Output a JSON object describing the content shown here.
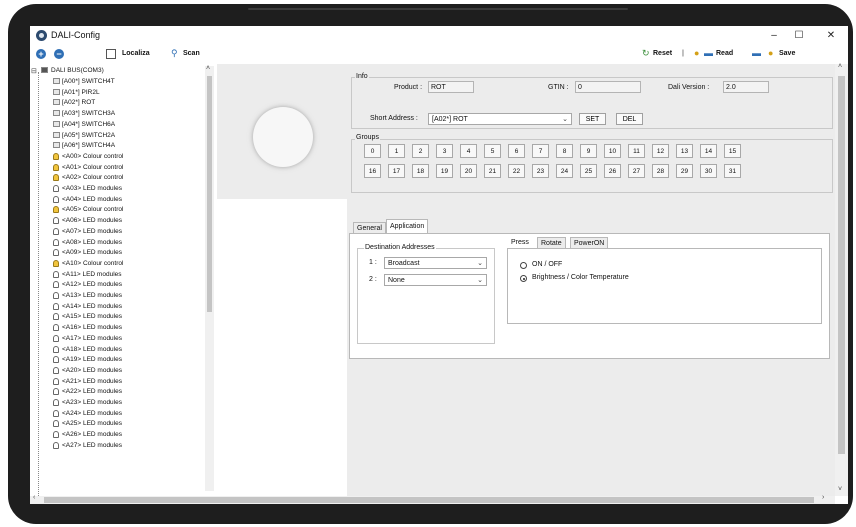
{
  "window": {
    "title": "DALI-Config",
    "controls": [
      "–",
      "☐",
      "✕"
    ]
  },
  "toolbar": {
    "add_icon": "+",
    "remove_icon": "−",
    "localiza_label": "Localiza",
    "scan_label": "Scan",
    "reset_label": "Reset",
    "separator": "|",
    "read_label": "Read",
    "save_label": "Save"
  },
  "tree": {
    "root": "DALI BUS(COM3)",
    "items": [
      {
        "label": "[A00*] SWITCH4T",
        "icon": "device"
      },
      {
        "label": "[A01*] PIR2L",
        "icon": "device"
      },
      {
        "label": "[A02*] ROT",
        "icon": "device"
      },
      {
        "label": "[A03*] SWITCH3A",
        "icon": "device"
      },
      {
        "label": "[A04*] SWITCH6A",
        "icon": "device"
      },
      {
        "label": "[A05*] SWITCH2A",
        "icon": "device"
      },
      {
        "label": "[A06*] SWITCH4A",
        "icon": "device"
      },
      {
        "label": "<A00> Colour control",
        "icon": "colour"
      },
      {
        "label": "<A01> Colour control",
        "icon": "colour"
      },
      {
        "label": "<A02> Colour control",
        "icon": "colour"
      },
      {
        "label": "<A03> LED modules",
        "icon": "led"
      },
      {
        "label": "<A04> LED modules",
        "icon": "led"
      },
      {
        "label": "<A05> Colour control",
        "icon": "colour"
      },
      {
        "label": "<A06> LED modules",
        "icon": "led"
      },
      {
        "label": "<A07> LED modules",
        "icon": "led"
      },
      {
        "label": "<A08> LED modules",
        "icon": "led"
      },
      {
        "label": "<A09> LED modules",
        "icon": "led"
      },
      {
        "label": "<A10> Colour control",
        "icon": "colour"
      },
      {
        "label": "<A11> LED modules",
        "icon": "led"
      },
      {
        "label": "<A12> LED modules",
        "icon": "led"
      },
      {
        "label": "<A13> LED modules",
        "icon": "led"
      },
      {
        "label": "<A14> LED modules",
        "icon": "led"
      },
      {
        "label": "<A15> LED modules",
        "icon": "led"
      },
      {
        "label": "<A16> LED modules",
        "icon": "led"
      },
      {
        "label": "<A17> LED modules",
        "icon": "led"
      },
      {
        "label": "<A18> LED modules",
        "icon": "led"
      },
      {
        "label": "<A19> LED modules",
        "icon": "led"
      },
      {
        "label": "<A20> LED modules",
        "icon": "led"
      },
      {
        "label": "<A21> LED modules",
        "icon": "led"
      },
      {
        "label": "<A22> LED modules",
        "icon": "led"
      },
      {
        "label": "<A23> LED modules",
        "icon": "led"
      },
      {
        "label": "<A24> LED modules",
        "icon": "led"
      },
      {
        "label": "<A25> LED modules",
        "icon": "led"
      },
      {
        "label": "<A26> LED modules",
        "icon": "led"
      },
      {
        "label": "<A27> LED modules",
        "icon": "led"
      }
    ]
  },
  "info": {
    "legend": "Info",
    "product_label": "Product :",
    "product_value": "ROT",
    "gtin_label": "GTIN :",
    "gtin_value": "0",
    "dali_version_label": "Dali Version :",
    "dali_version_value": "2.0",
    "short_address_label": "Short Address :",
    "short_address_value": "[A02*] ROT",
    "set_label": "SET",
    "del_label": "DEL"
  },
  "groups": {
    "legend": "Groups",
    "buttons": [
      "0",
      "1",
      "2",
      "3",
      "4",
      "5",
      "6",
      "7",
      "8",
      "9",
      "10",
      "11",
      "12",
      "13",
      "14",
      "15",
      "16",
      "17",
      "18",
      "19",
      "20",
      "21",
      "22",
      "23",
      "24",
      "25",
      "26",
      "27",
      "28",
      "29",
      "30",
      "31"
    ]
  },
  "tabs": {
    "main": [
      "General",
      "Application"
    ],
    "active_main": "Application",
    "sub": [
      "Press",
      "Rotate",
      "PowerON"
    ],
    "active_sub": "Press"
  },
  "destination": {
    "legend": "Destination Addresses",
    "rows": [
      {
        "index": "1 :",
        "value": "Broadcast"
      },
      {
        "index": "2 :",
        "value": "None"
      }
    ]
  },
  "press_options": [
    {
      "label": "ON / OFF",
      "selected": false
    },
    {
      "label": "Brightness / Color Temperature",
      "selected": true
    }
  ],
  "colors": {
    "accent": "#2f6fb5",
    "panel_bg": "#ececec",
    "device_frame": "#1e1e1e"
  }
}
